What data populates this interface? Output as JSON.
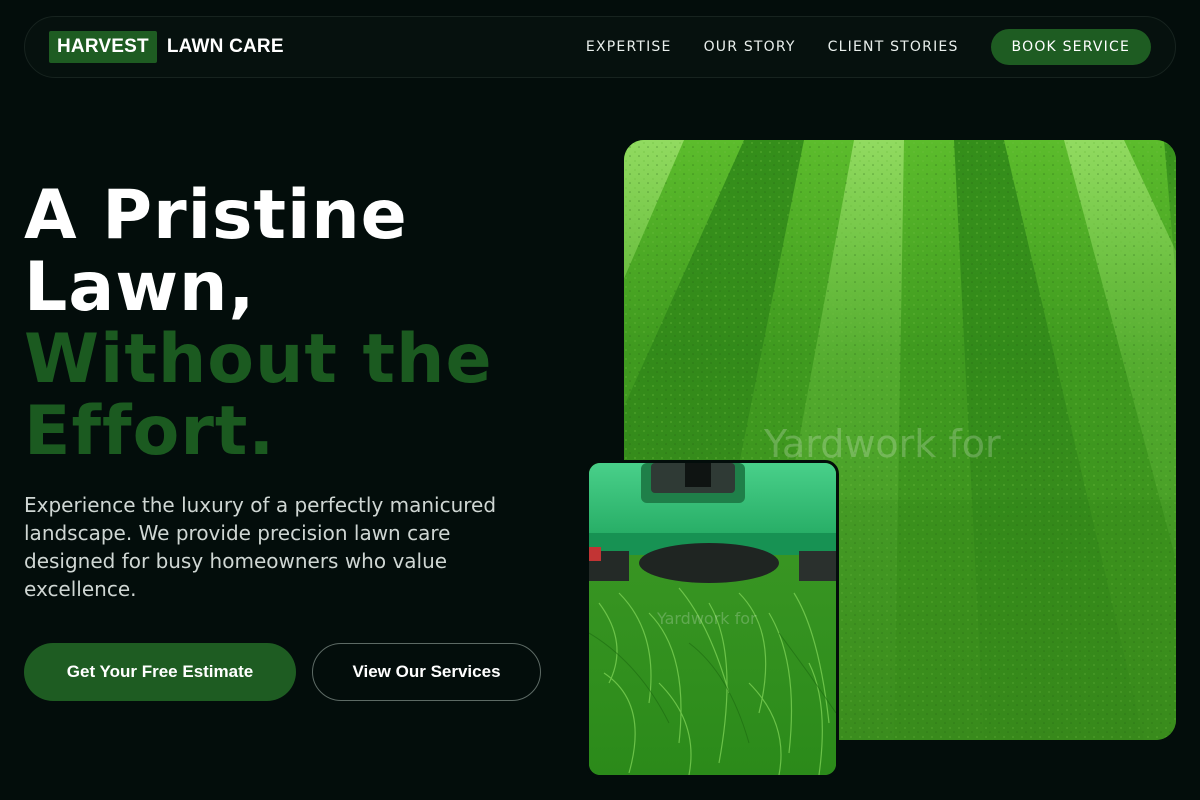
{
  "nav": {
    "brand_badge": "HARVEST",
    "brand_rest": "LAWN CARE",
    "links": [
      "EXPERTISE",
      "OUR STORY",
      "CLIENT STORIES"
    ],
    "book_label": "BOOK SERVICE"
  },
  "hero": {
    "headline_line1": "A Pristine",
    "headline_line2": "Lawn,",
    "headline_line3": "Without the",
    "headline_line4": "Effort.",
    "lede": "Experience the luxury of a perfectly manicured landscape. We provide precision lawn care designed for busy homeowners who value excellence.",
    "cta_primary": "Get Your Free Estimate",
    "cta_secondary": "View Our Services"
  },
  "images": {
    "main_alt": "striped-mowed-lawn",
    "main_watermark": "Yardwork for",
    "small_alt": "green-lawn-mower-cutting-grass",
    "small_watermark": "Yardwork for"
  },
  "colors": {
    "background": "#030d0b",
    "accent_green": "#1e5c22",
    "headline_green": "#1b5a20",
    "lede_text": "#cfd6d3"
  }
}
